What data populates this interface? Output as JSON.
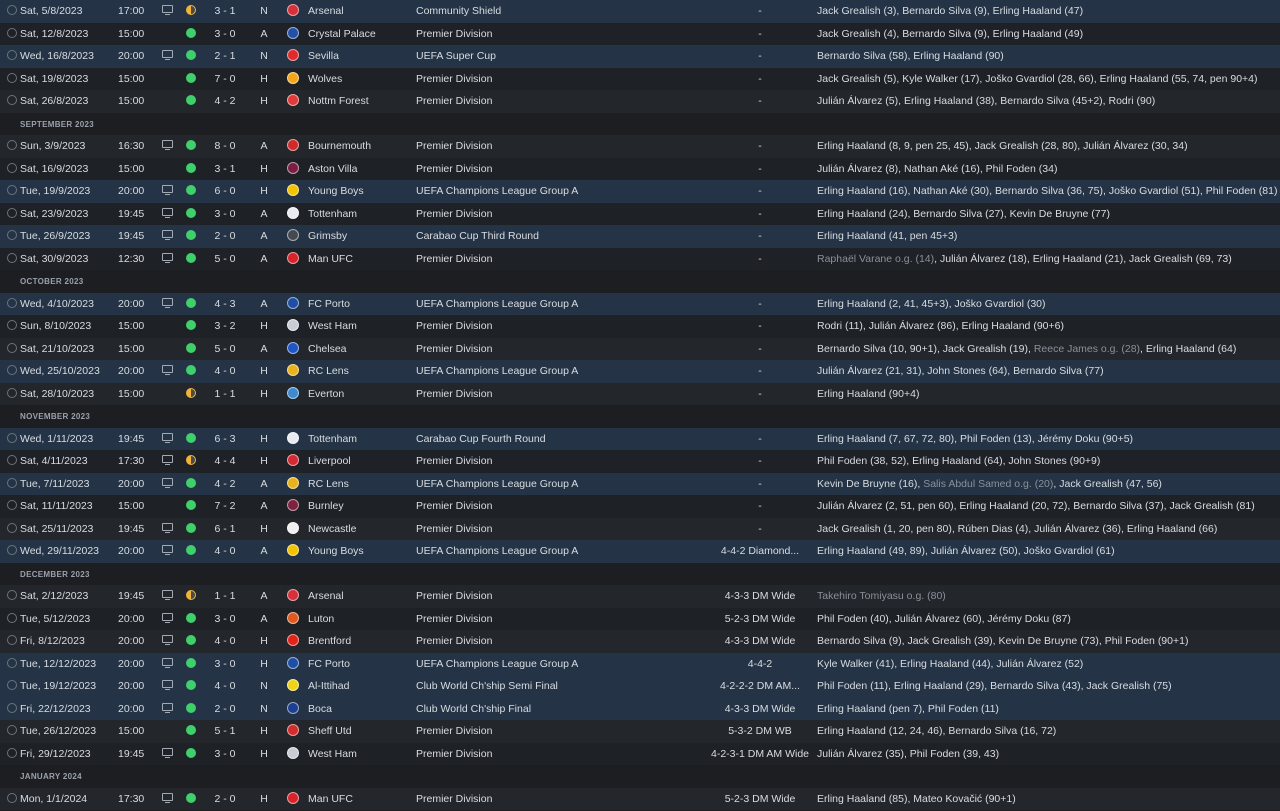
{
  "colors": {
    "win": "#3fcf6b",
    "draw": "#f0b43a",
    "highlight_row": "#243446"
  },
  "rows": [
    {
      "kind": "match",
      "date": "Sat, 5/8/2023",
      "time": "17:00",
      "tv": true,
      "res": "D",
      "score": "3 - 1",
      "venue": "N",
      "opp": "Arsenal",
      "badge": "#d6303a",
      "comp": "Community Shield",
      "form": "-",
      "scorers": [
        {
          "t": "Jack Grealish (3), Bernardo Silva (9), Erling Haaland (47)"
        }
      ],
      "hl": true
    },
    {
      "kind": "match",
      "date": "Sat, 12/8/2023",
      "time": "15:00",
      "tv": false,
      "res": "W",
      "score": "3 - 0",
      "venue": "A",
      "opp": "Crystal Palace",
      "badge": "#2350a8",
      "comp": "Premier Division",
      "form": "-",
      "scorers": [
        {
          "t": "Jack Grealish (4), Bernardo Silva (9), Erling Haaland (49)"
        }
      ]
    },
    {
      "kind": "match",
      "date": "Wed, 16/8/2023",
      "time": "20:00",
      "tv": true,
      "res": "W",
      "score": "2 - 1",
      "venue": "N",
      "opp": "Sevilla",
      "badge": "#e02b2b",
      "comp": "UEFA Super Cup",
      "form": "-",
      "scorers": [
        {
          "t": "Bernardo Silva (58), Erling Haaland (90)"
        }
      ],
      "hl": true
    },
    {
      "kind": "match",
      "date": "Sat, 19/8/2023",
      "time": "15:00",
      "tv": false,
      "res": "W",
      "score": "7 - 0",
      "venue": "H",
      "opp": "Wolves",
      "badge": "#f3a51b",
      "comp": "Premier Division",
      "form": "-",
      "scorers": [
        {
          "t": "Jack Grealish (5), Kyle Walker (17), Joško Gvardiol (28, 66), Erling Haaland (55, 74, pen 90+4)"
        }
      ]
    },
    {
      "kind": "match",
      "date": "Sat, 26/8/2023",
      "time": "15:00",
      "tv": false,
      "res": "W",
      "score": "4 - 2",
      "venue": "H",
      "opp": "Nottm Forest",
      "badge": "#e03b3b",
      "comp": "Premier Division",
      "form": "-",
      "scorers": [
        {
          "t": "Julián Álvarez (5), Erling Haaland (38), Bernardo Silva (45+2), Rodri (90)"
        }
      ]
    },
    {
      "kind": "month",
      "label": "SEPTEMBER 2023"
    },
    {
      "kind": "match",
      "date": "Sun, 3/9/2023",
      "time": "16:30",
      "tv": true,
      "res": "W",
      "score": "8 - 0",
      "venue": "A",
      "opp": "Bournemouth",
      "badge": "#cf2a2a",
      "comp": "Premier Division",
      "form": "-",
      "scorers": [
        {
          "t": "Erling Haaland (8, 9, pen 25, 45), Jack Grealish (28, 80), Julián Álvarez (30, 34)"
        }
      ]
    },
    {
      "kind": "match",
      "date": "Sat, 16/9/2023",
      "time": "15:00",
      "tv": false,
      "res": "W",
      "score": "3 - 1",
      "venue": "H",
      "opp": "Aston Villa",
      "badge": "#7a1e44",
      "comp": "Premier Division",
      "form": "-",
      "scorers": [
        {
          "t": "Julián Álvarez (8), Nathan Aké (16), Phil Foden (34)"
        }
      ]
    },
    {
      "kind": "match",
      "date": "Tue, 19/9/2023",
      "time": "20:00",
      "tv": true,
      "res": "W",
      "score": "6 - 0",
      "venue": "H",
      "opp": "Young Boys",
      "badge": "#f2c300",
      "comp": "UEFA Champions League Group A",
      "form": "-",
      "scorers": [
        {
          "t": "Erling Haaland (16), Nathan Aké (30), Bernardo Silva (36, 75), Joško Gvardiol (51), Phil Foden (81)"
        }
      ],
      "hl": true
    },
    {
      "kind": "match",
      "date": "Sat, 23/9/2023",
      "time": "19:45",
      "tv": true,
      "res": "W",
      "score": "3 - 0",
      "venue": "A",
      "opp": "Tottenham",
      "badge": "#e8ecf2",
      "comp": "Premier Division",
      "form": "-",
      "scorers": [
        {
          "t": "Erling Haaland (24), Bernardo Silva (27), Kevin De Bruyne (77)"
        }
      ]
    },
    {
      "kind": "match",
      "date": "Tue, 26/9/2023",
      "time": "19:45",
      "tv": true,
      "res": "W",
      "score": "2 - 0",
      "venue": "A",
      "opp": "Grimsby",
      "badge": "#444a52",
      "comp": "Carabao Cup Third Round",
      "form": "-",
      "scorers": [
        {
          "t": "Erling Haaland (41, pen 45+3)"
        }
      ],
      "hl": true
    },
    {
      "kind": "match",
      "date": "Sat, 30/9/2023",
      "time": "12:30",
      "tv": true,
      "res": "W",
      "score": "5 - 0",
      "venue": "A",
      "opp": "Man UFC",
      "badge": "#d8232a",
      "comp": "Premier Division",
      "form": "-",
      "scorers": [
        {
          "t": "Raphaël Varane o.g. (14)",
          "og": true
        },
        {
          "t": ", Julián Álvarez (18), Erling Haaland (21), Jack Grealish (69, 73)"
        }
      ]
    },
    {
      "kind": "month",
      "label": "OCTOBER 2023"
    },
    {
      "kind": "match",
      "date": "Wed, 4/10/2023",
      "time": "20:00",
      "tv": true,
      "res": "W",
      "score": "4 - 3",
      "venue": "A",
      "opp": "FC Porto",
      "badge": "#1f4fa5",
      "comp": "UEFA Champions League Group A",
      "form": "-",
      "scorers": [
        {
          "t": "Erling Haaland (2, 41, 45+3), Joško Gvardiol (30)"
        }
      ],
      "hl": true
    },
    {
      "kind": "match",
      "date": "Sun, 8/10/2023",
      "time": "15:00",
      "tv": false,
      "res": "W",
      "score": "3 - 2",
      "venue": "H",
      "opp": "West Ham",
      "badge": "#c9cdd6",
      "comp": "Premier Division",
      "form": "-",
      "scorers": [
        {
          "t": "Rodri (11), Julián Álvarez (86), Erling Haaland (90+6)"
        }
      ]
    },
    {
      "kind": "match",
      "date": "Sat, 21/10/2023",
      "time": "15:00",
      "tv": false,
      "res": "W",
      "score": "5 - 0",
      "venue": "A",
      "opp": "Chelsea",
      "badge": "#1f56c4",
      "comp": "Premier Division",
      "form": "-",
      "scorers": [
        {
          "t": "Bernardo Silva (10, 90+1), Jack Grealish (19), "
        },
        {
          "t": "Reece James o.g. (28)",
          "og": true
        },
        {
          "t": ", Erling Haaland (64)"
        }
      ]
    },
    {
      "kind": "match",
      "date": "Wed, 25/10/2023",
      "time": "20:00",
      "tv": true,
      "res": "W",
      "score": "4 - 0",
      "venue": "H",
      "opp": "RC Lens",
      "badge": "#e8b21c",
      "comp": "UEFA Champions League Group A",
      "form": "-",
      "scorers": [
        {
          "t": "Julián Álvarez (21, 31), John Stones (64), Bernardo Silva (77)"
        }
      ],
      "hl": true
    },
    {
      "kind": "match",
      "date": "Sat, 28/10/2023",
      "time": "15:00",
      "tv": false,
      "res": "D",
      "score": "1 - 1",
      "venue": "H",
      "opp": "Everton",
      "badge": "#3e8ad0",
      "comp": "Premier Division",
      "form": "-",
      "scorers": [
        {
          "t": "Erling Haaland (90+4)"
        }
      ]
    },
    {
      "kind": "month",
      "label": "NOVEMBER 2023"
    },
    {
      "kind": "match",
      "date": "Wed, 1/11/2023",
      "time": "19:45",
      "tv": true,
      "res": "W",
      "score": "6 - 3",
      "venue": "H",
      "opp": "Tottenham",
      "badge": "#e8ecf2",
      "comp": "Carabao Cup Fourth Round",
      "form": "-",
      "scorers": [
        {
          "t": "Erling Haaland (7, 67, 72, 80), Phil Foden (13), Jérémy Doku (90+5)"
        }
      ],
      "hl": true
    },
    {
      "kind": "match",
      "date": "Sat, 4/11/2023",
      "time": "17:30",
      "tv": true,
      "res": "D",
      "score": "4 - 4",
      "venue": "H",
      "opp": "Liverpool",
      "badge": "#d52a33",
      "comp": "Premier Division",
      "form": "-",
      "scorers": [
        {
          "t": "Phil Foden (38, 52), Erling Haaland (64), John Stones (90+9)"
        }
      ]
    },
    {
      "kind": "match",
      "date": "Tue, 7/11/2023",
      "time": "20:00",
      "tv": true,
      "res": "W",
      "score": "4 - 2",
      "venue": "A",
      "opp": "RC Lens",
      "badge": "#e8b21c",
      "comp": "UEFA Champions League Group A",
      "form": "-",
      "scorers": [
        {
          "t": "Kevin De Bruyne (16), "
        },
        {
          "t": "Salis Abdul Samed o.g. (20)",
          "og": true
        },
        {
          "t": ", Jack Grealish (47, 56)"
        }
      ],
      "hl": true
    },
    {
      "kind": "match",
      "date": "Sat, 11/11/2023",
      "time": "15:00",
      "tv": false,
      "res": "W",
      "score": "7 - 2",
      "venue": "A",
      "opp": "Burnley",
      "badge": "#7d2340",
      "comp": "Premier Division",
      "form": "-",
      "scorers": [
        {
          "t": "Julián Álvarez (2, 51, pen 60), Erling Haaland (20, 72), Bernardo Silva (37), Jack Grealish (81)"
        }
      ]
    },
    {
      "kind": "match",
      "date": "Sat, 25/11/2023",
      "time": "19:45",
      "tv": true,
      "res": "W",
      "score": "6 - 1",
      "venue": "H",
      "opp": "Newcastle",
      "badge": "#f0f0f0",
      "comp": "Premier Division",
      "form": "-",
      "scorers": [
        {
          "t": "Jack Grealish (1, 20, pen 80), Rúben Dias (4), Julián Álvarez (36), Erling Haaland (66)"
        }
      ]
    },
    {
      "kind": "match",
      "date": "Wed, 29/11/2023",
      "time": "20:00",
      "tv": true,
      "res": "W",
      "score": "4 - 0",
      "venue": "A",
      "opp": "Young Boys",
      "badge": "#f2c300",
      "comp": "UEFA Champions League Group A",
      "form": "4-4-2 Diamond...",
      "scorers": [
        {
          "t": "Erling Haaland (49, 89), Julián Álvarez (50), Joško Gvardiol (61)"
        }
      ],
      "hl": true
    },
    {
      "kind": "month",
      "label": "DECEMBER 2023"
    },
    {
      "kind": "match",
      "date": "Sat, 2/12/2023",
      "time": "19:45",
      "tv": true,
      "res": "D",
      "score": "1 - 1",
      "venue": "A",
      "opp": "Arsenal",
      "badge": "#d6303a",
      "comp": "Premier Division",
      "form": "4-3-3 DM Wide",
      "scorers": [
        {
          "t": "Takehiro Tomiyasu o.g. (80)",
          "og": true
        }
      ]
    },
    {
      "kind": "match",
      "date": "Tue, 5/12/2023",
      "time": "20:00",
      "tv": true,
      "res": "W",
      "score": "3 - 0",
      "venue": "A",
      "opp": "Luton",
      "badge": "#e05a1e",
      "comp": "Premier Division",
      "form": "5-2-3 DM Wide",
      "scorers": [
        {
          "t": "Phil Foden (40), Julián Álvarez (60), Jérémy Doku (87)"
        }
      ]
    },
    {
      "kind": "match",
      "date": "Fri, 8/12/2023",
      "time": "20:00",
      "tv": true,
      "res": "W",
      "score": "4 - 0",
      "venue": "H",
      "opp": "Brentford",
      "badge": "#e2231a",
      "comp": "Premier Division",
      "form": "4-3-3 DM Wide",
      "scorers": [
        {
          "t": "Bernardo Silva (9), Jack Grealish (39), Kevin De Bruyne (73), Phil Foden (90+1)"
        }
      ]
    },
    {
      "kind": "match",
      "date": "Tue, 12/12/2023",
      "time": "20:00",
      "tv": true,
      "res": "W",
      "score": "3 - 0",
      "venue": "H",
      "opp": "FC Porto",
      "badge": "#1f4fa5",
      "comp": "UEFA Champions League Group A",
      "form": "4-4-2",
      "scorers": [
        {
          "t": "Kyle Walker (41), Erling Haaland (44), Julián Álvarez (52)"
        }
      ],
      "hl": true
    },
    {
      "kind": "match",
      "date": "Tue, 19/12/2023",
      "time": "20:00",
      "tv": true,
      "res": "W",
      "score": "4 - 0",
      "venue": "N",
      "opp": "Al-Ittihad",
      "badge": "#f1d21a",
      "comp": "Club World Ch'ship Semi Final",
      "form": "4-2-2-2 DM AM...",
      "scorers": [
        {
          "t": "Phil Foden (11), Erling Haaland (29), Bernardo Silva (43), Jack Grealish (75)"
        }
      ],
      "hl": true
    },
    {
      "kind": "match",
      "date": "Fri, 22/12/2023",
      "time": "20:00",
      "tv": true,
      "res": "W",
      "score": "2 - 0",
      "venue": "N",
      "opp": "Boca",
      "badge": "#1c3f8f",
      "comp": "Club World Ch'ship Final",
      "form": "4-3-3 DM Wide",
      "scorers": [
        {
          "t": "Erling Haaland (pen 7), Phil Foden (11)"
        }
      ],
      "hl": true
    },
    {
      "kind": "match",
      "date": "Tue, 26/12/2023",
      "time": "15:00",
      "tv": false,
      "res": "W",
      "score": "5 - 1",
      "venue": "H",
      "opp": "Sheff Utd",
      "badge": "#d32c2c",
      "comp": "Premier Division",
      "form": "5-3-2 DM WB",
      "scorers": [
        {
          "t": "Erling Haaland (12, 24, 46), Bernardo Silva (16, 72)"
        }
      ]
    },
    {
      "kind": "match",
      "date": "Fri, 29/12/2023",
      "time": "19:45",
      "tv": true,
      "res": "W",
      "score": "3 - 0",
      "venue": "H",
      "opp": "West Ham",
      "badge": "#c9cdd6",
      "comp": "Premier Division",
      "form": "4-2-3-1 DM AM Wide",
      "scorers": [
        {
          "t": "Julián Álvarez (35), Phil Foden (39, 43)"
        }
      ]
    },
    {
      "kind": "month",
      "label": "JANUARY 2024"
    },
    {
      "kind": "match",
      "date": "Mon, 1/1/2024",
      "time": "17:30",
      "tv": true,
      "res": "W",
      "score": "2 - 0",
      "venue": "H",
      "opp": "Man UFC",
      "badge": "#d8232a",
      "comp": "Premier Division",
      "form": "5-2-3 DM Wide",
      "scorers": [
        {
          "t": "Erling Haaland (85), Mateo Kovačić (90+1)"
        }
      ]
    }
  ]
}
